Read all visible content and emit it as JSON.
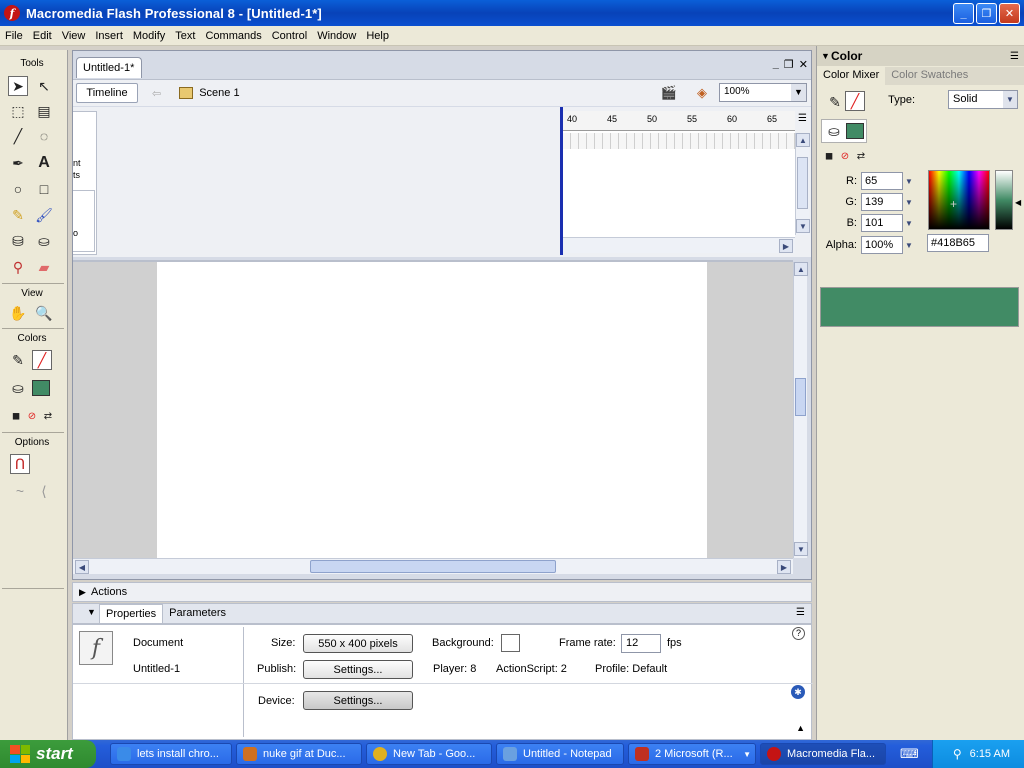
{
  "window": {
    "title": "Macromedia Flash Professional 8 - [Untitled-1*]"
  },
  "menu": [
    "File",
    "Edit",
    "View",
    "Insert",
    "Modify",
    "Text",
    "Commands",
    "Control",
    "Window",
    "Help"
  ],
  "tools": {
    "header": "Tools",
    "view_header": "View",
    "colors_header": "Colors",
    "options_header": "Options"
  },
  "document": {
    "tab": "Untitled-1*",
    "timeline_label": "Timeline",
    "scene_label": "Scene 1",
    "zoom": "100%",
    "ruler_ticks": [
      "40",
      "45",
      "50",
      "55",
      "60",
      "65"
    ],
    "layer_text": [
      "nt",
      "ts",
      "o"
    ]
  },
  "panels": {
    "actions": "Actions",
    "properties_tab": "Properties",
    "parameters_tab": "Parameters"
  },
  "properties": {
    "doc_type": "Document",
    "doc_name": "Untitled-1",
    "size_label": "Size:",
    "size_value": "550 x 400 pixels",
    "background_label": "Background:",
    "frame_rate_label": "Frame rate:",
    "frame_rate": "12",
    "fps": "fps",
    "publish_label": "Publish:",
    "settings_button": "Settings...",
    "player": "Player: 8",
    "actionscript": "ActionScript:  2",
    "profile": "Profile:  Default",
    "device_label": "Device:",
    "device_button": "Settings..."
  },
  "color": {
    "header": "Color",
    "mixer_tab": "Color Mixer",
    "swatches_tab": "Color Swatches",
    "type_label": "Type:",
    "type_value": "Solid",
    "r_label": "R:",
    "r": "65",
    "g_label": "G:",
    "g": "139",
    "b_label": "B:",
    "b": "101",
    "alpha_label": "Alpha:",
    "alpha": "100%",
    "hex": "#418B65",
    "fill_color": "#418b65"
  },
  "taskbar": {
    "start": "start",
    "tasks": [
      {
        "label": "lets install chro...",
        "color": "#3a8be8"
      },
      {
        "label": "nuke gif at Duc...",
        "color": "#d07020"
      },
      {
        "label": "New Tab - Goo...",
        "color": "#e0b020"
      },
      {
        "label": "Untitled - Notepad",
        "color": "#6aa0e0"
      },
      {
        "label": "2 Microsoft (R...",
        "color": "#c03020"
      },
      {
        "label": "Macromedia Fla...",
        "color": "#c41414"
      }
    ],
    "clock": "6:15 AM"
  }
}
